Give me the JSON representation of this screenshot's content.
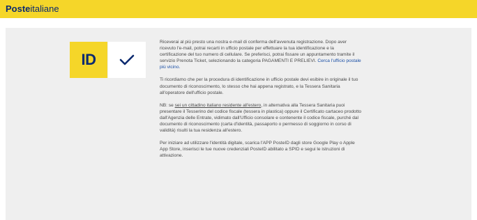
{
  "header": {
    "brand_bold": "Poste",
    "brand_light": "italiane"
  },
  "icons": {
    "id_label": "ID",
    "check_icon": "checkmark-icon",
    "accent_color": "#f5d629",
    "brand_color": "#0b2a6f",
    "link_color": "#1a4fa5"
  },
  "body": {
    "p1_text": "Riceverai al più presto una nostra e-mail di conferma dell'avvenuta registrazione. Dopo aver ricevuto l'e-mail, potrai recarti in ufficio postale per effettuare la tua identificazione e la certificazione del tuo numero di cellulare. Se preferisci, potrai fissare un appuntamento tramite il servizio Prenota Ticket, selezionando la categoria PAGAMENTI E PRELIEVI.",
    "p1_link": "Cerca l'ufficio postale più vicino.",
    "p2": "Ti ricordiamo che per la procedura di identificazione in ufficio postale devi esibire in originale il tuo documento di riconoscimento, lo stesso che hai appena registrato, e la Tessera Sanitaria all'operatore dell'ufficio postale.",
    "p3_prefix": "NB: se ",
    "p3_underlined": "sei un cittadino italiano residente all'estero",
    "p3_rest": ", in alternativa alla Tessera Sanitaria puoi presentare il Tesserino del codice fiscale (tessera in plastica) oppure il Certificato cartaceo prodotto dall'Agenzia delle Entrate, vidimato dall'Ufficio consolare e contenente il codice fiscale, purché dal documento di riconoscimento (carta d'identità, passaporto o permesso di soggiorno in corso di validità) risulti la tua residenza all'estero.",
    "p4": "Per iniziare ad utilizzare l'identità digitale, scarica l'APP PosteID dagli store Google Play o Apple App Store, inserisci le tue nuove credenziali PosteID abilitato a SPID e segui le istruzioni di attivazione."
  }
}
